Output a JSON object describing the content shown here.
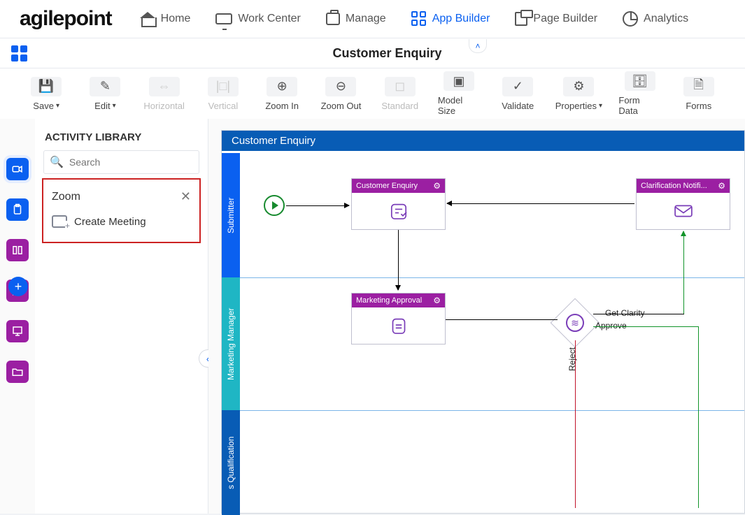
{
  "brand": "agilepoint",
  "nav": {
    "home": "Home",
    "work_center": "Work Center",
    "manage": "Manage",
    "app_builder": "App Builder",
    "page_builder": "Page Builder",
    "analytics": "Analytics"
  },
  "page_title": "Customer Enquiry",
  "toolbar": {
    "save": "Save",
    "edit": "Edit",
    "horizontal": "Horizontal",
    "vertical": "Vertical",
    "zoom_in": "Zoom In",
    "zoom_out": "Zoom Out",
    "standard": "Standard",
    "model_size": "Model Size",
    "validate": "Validate",
    "properties": "Properties",
    "form_data": "Form Data",
    "forms": "Forms"
  },
  "library": {
    "title": "ACTIVITY LIBRARY",
    "search_placeholder": "Search",
    "category": "Zoom",
    "activities": {
      "create_meeting": "Create Meeting"
    }
  },
  "flow": {
    "title": "Customer Enquiry",
    "lanes": {
      "submitter": "Submitter",
      "marketing_manager": "Marketing Manager",
      "qualification": "s Qualification"
    },
    "nodes": {
      "customer_enquiry": "Customer Enquiry",
      "clarification": "Clarification Notifi...",
      "marketing_approval": "Marketing Approval"
    },
    "edges": {
      "get_clarity": "Get Clarity",
      "approve": "Approve",
      "reject": "Reject"
    }
  }
}
